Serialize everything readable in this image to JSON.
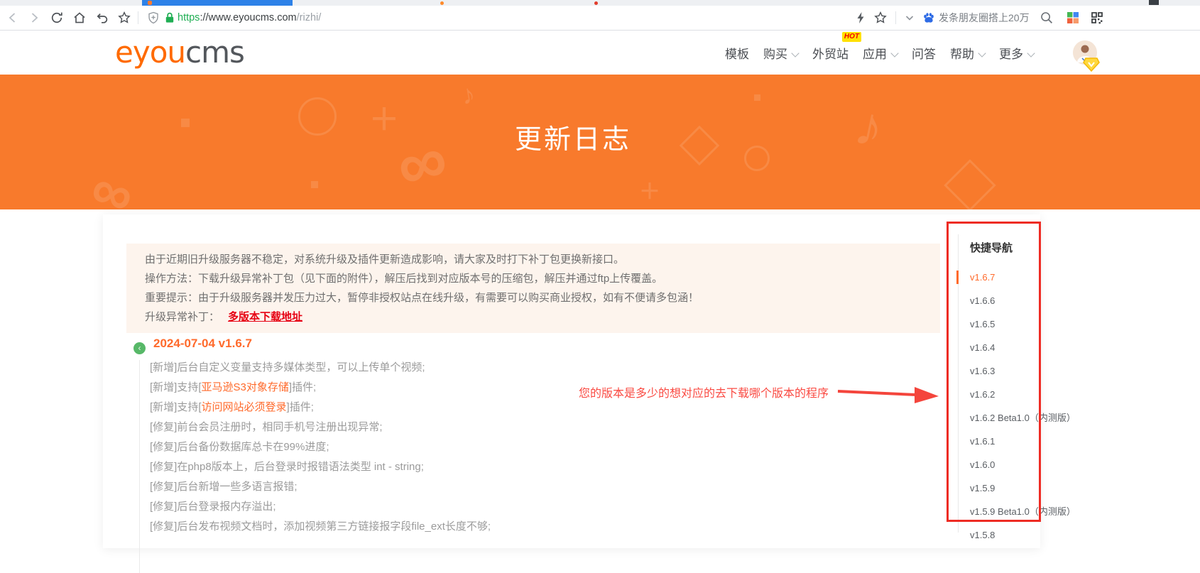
{
  "colors": {
    "banner_orange": "#f87a2c",
    "accent_orange": "#ff6a2b",
    "link_red": "#e60012",
    "annotation_red": "#ee2c24",
    "active_tab_blue": "#2e82e8",
    "lock_green": "#1fae53"
  },
  "browser": {
    "url_scheme": "https",
    "url_host": "://www.eyoucms.com",
    "url_path": "/rizhi/",
    "search_text": "发条朋友圈搭上20万"
  },
  "header": {
    "logo_orange": "eyou",
    "logo_gray": "cms",
    "nav": [
      {
        "label": "模板"
      },
      {
        "label": "购买"
      },
      {
        "label": "外贸站",
        "badge": "HOT"
      },
      {
        "label": "应用"
      },
      {
        "label": "问答"
      },
      {
        "label": "帮助"
      },
      {
        "label": "更多"
      }
    ]
  },
  "hero": {
    "title": "更新日志",
    "pattern": [
      "∞",
      "♪",
      "＋",
      "＋",
      "♪",
      "∞"
    ]
  },
  "notice": {
    "lines": [
      "由于近期旧升级服务器不稳定，对系统升级及插件更新造成影响，请大家及时打下补丁包更换新接口。",
      "操作方法：下载升级异常补丁包（见下面的附件），解压后找到对应版本号的压缩包，解压并通过ftp上传覆盖。",
      "重要提示：由于升级服务器并发压力过大，暂停非授权站点在线升级，有需要可以购买商业授权，如有不便请多包涵！"
    ],
    "patch_label": "升级异常补丁：",
    "patch_link": "多版本下载地址"
  },
  "changelog": {
    "collapse_glyph": "‹",
    "heading": "2024-07-04 v1.6.7",
    "items": [
      {
        "pre": "[新增]后台自定义变量支持多媒体类型，可以上传单个视频;"
      },
      {
        "pre": "[新增]支持[",
        "hl": "亚马逊S3对象存储",
        "post": "]插件;"
      },
      {
        "pre": "[新增]支持[",
        "hl": "访问网站必须登录",
        "post": "]插件;"
      },
      {
        "pre": "[修复]前台会员注册时，相同手机号注册出现异常;"
      },
      {
        "pre": "[修复]后台备份数据库总卡在99%进度;"
      },
      {
        "pre": "[修复]在php8版本上，后台登录时报错语法类型 int - string;"
      },
      {
        "pre": "[修复]后台新增一些多语言报错;"
      },
      {
        "pre": "[修复]后台登录报内存溢出;"
      },
      {
        "pre": "[修复]后台发布视频文档时，添加视频第三方链接报字段file_ext长度不够;"
      }
    ]
  },
  "sidebar": {
    "title": "快捷导航",
    "versions": [
      {
        "label": "v1.6.7"
      },
      {
        "label": "v1.6.6"
      },
      {
        "label": "v1.6.5"
      },
      {
        "label": "v1.6.4"
      },
      {
        "label": "v1.6.3"
      },
      {
        "label": "v1.6.2"
      },
      {
        "label": "v1.6.2 Beta1.0（内测版）"
      },
      {
        "label": "v1.6.1"
      },
      {
        "label": "v1.6.0"
      },
      {
        "label": "v1.5.9"
      },
      {
        "label": "v1.5.9 Beta1.0（内测版）"
      },
      {
        "label": "v1.5.8"
      }
    ]
  },
  "annotation": {
    "text": "您的版本是多少的想对应的去下载哪个版本的程序"
  }
}
